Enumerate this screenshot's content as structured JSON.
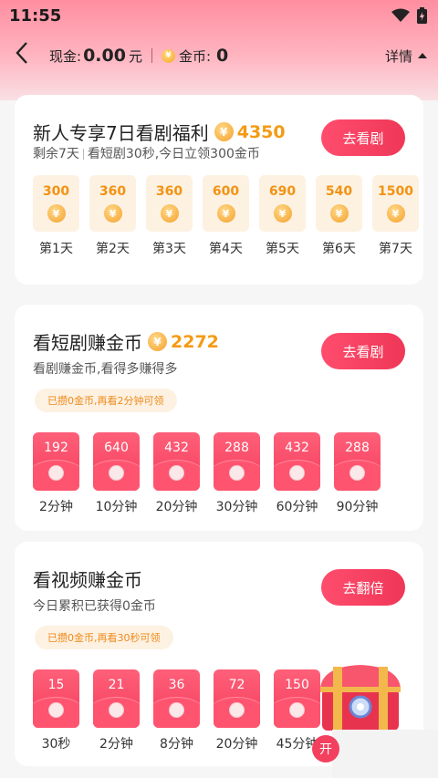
{
  "status": {
    "time": "11:55"
  },
  "header": {
    "cash_label": "现金:",
    "cash_value": "0.00",
    "cash_unit": "元",
    "coin_label": "金币:",
    "coin_value": "0",
    "details_label": "详情"
  },
  "newbie": {
    "title": "新人专享7日看剧福利",
    "amount": "4350",
    "remaining": "剩余7天",
    "subtitle": "看短剧30秒,今日立领300金币",
    "button": "去看剧",
    "days": [
      {
        "amount": "300",
        "label": "第1天"
      },
      {
        "amount": "360",
        "label": "第2天"
      },
      {
        "amount": "360",
        "label": "第3天"
      },
      {
        "amount": "600",
        "label": "第4天"
      },
      {
        "amount": "690",
        "label": "第5天"
      },
      {
        "amount": "540",
        "label": "第6天"
      },
      {
        "amount": "1500",
        "label": "第7天"
      }
    ]
  },
  "drama": {
    "title": "看短剧赚金币",
    "amount": "2272",
    "subtitle": "看剧赚金币,看得多赚得多",
    "tip": "已攒0金币,再看2分钟可领",
    "button": "去看剧",
    "rewards": [
      {
        "amount": "192",
        "label": "2分钟"
      },
      {
        "amount": "640",
        "label": "10分钟"
      },
      {
        "amount": "432",
        "label": "20分钟"
      },
      {
        "amount": "288",
        "label": "30分钟"
      },
      {
        "amount": "432",
        "label": "60分钟"
      },
      {
        "amount": "288",
        "label": "90分钟"
      }
    ]
  },
  "video": {
    "title": "看视频赚金币",
    "subtitle": "今日累积已获得0金币",
    "tip": "已攒0金币,再看30秒可领",
    "button": "去翻倍",
    "rewards": [
      {
        "amount": "15",
        "label": "30秒"
      },
      {
        "amount": "21",
        "label": "2分钟"
      },
      {
        "amount": "36",
        "label": "8分钟"
      },
      {
        "amount": "72",
        "label": "20分钟"
      },
      {
        "amount": "150",
        "label": "45分钟"
      }
    ]
  },
  "floating": {
    "label": "开"
  },
  "colors": {
    "accent": "#f33c5c",
    "coin": "#f59a14"
  }
}
